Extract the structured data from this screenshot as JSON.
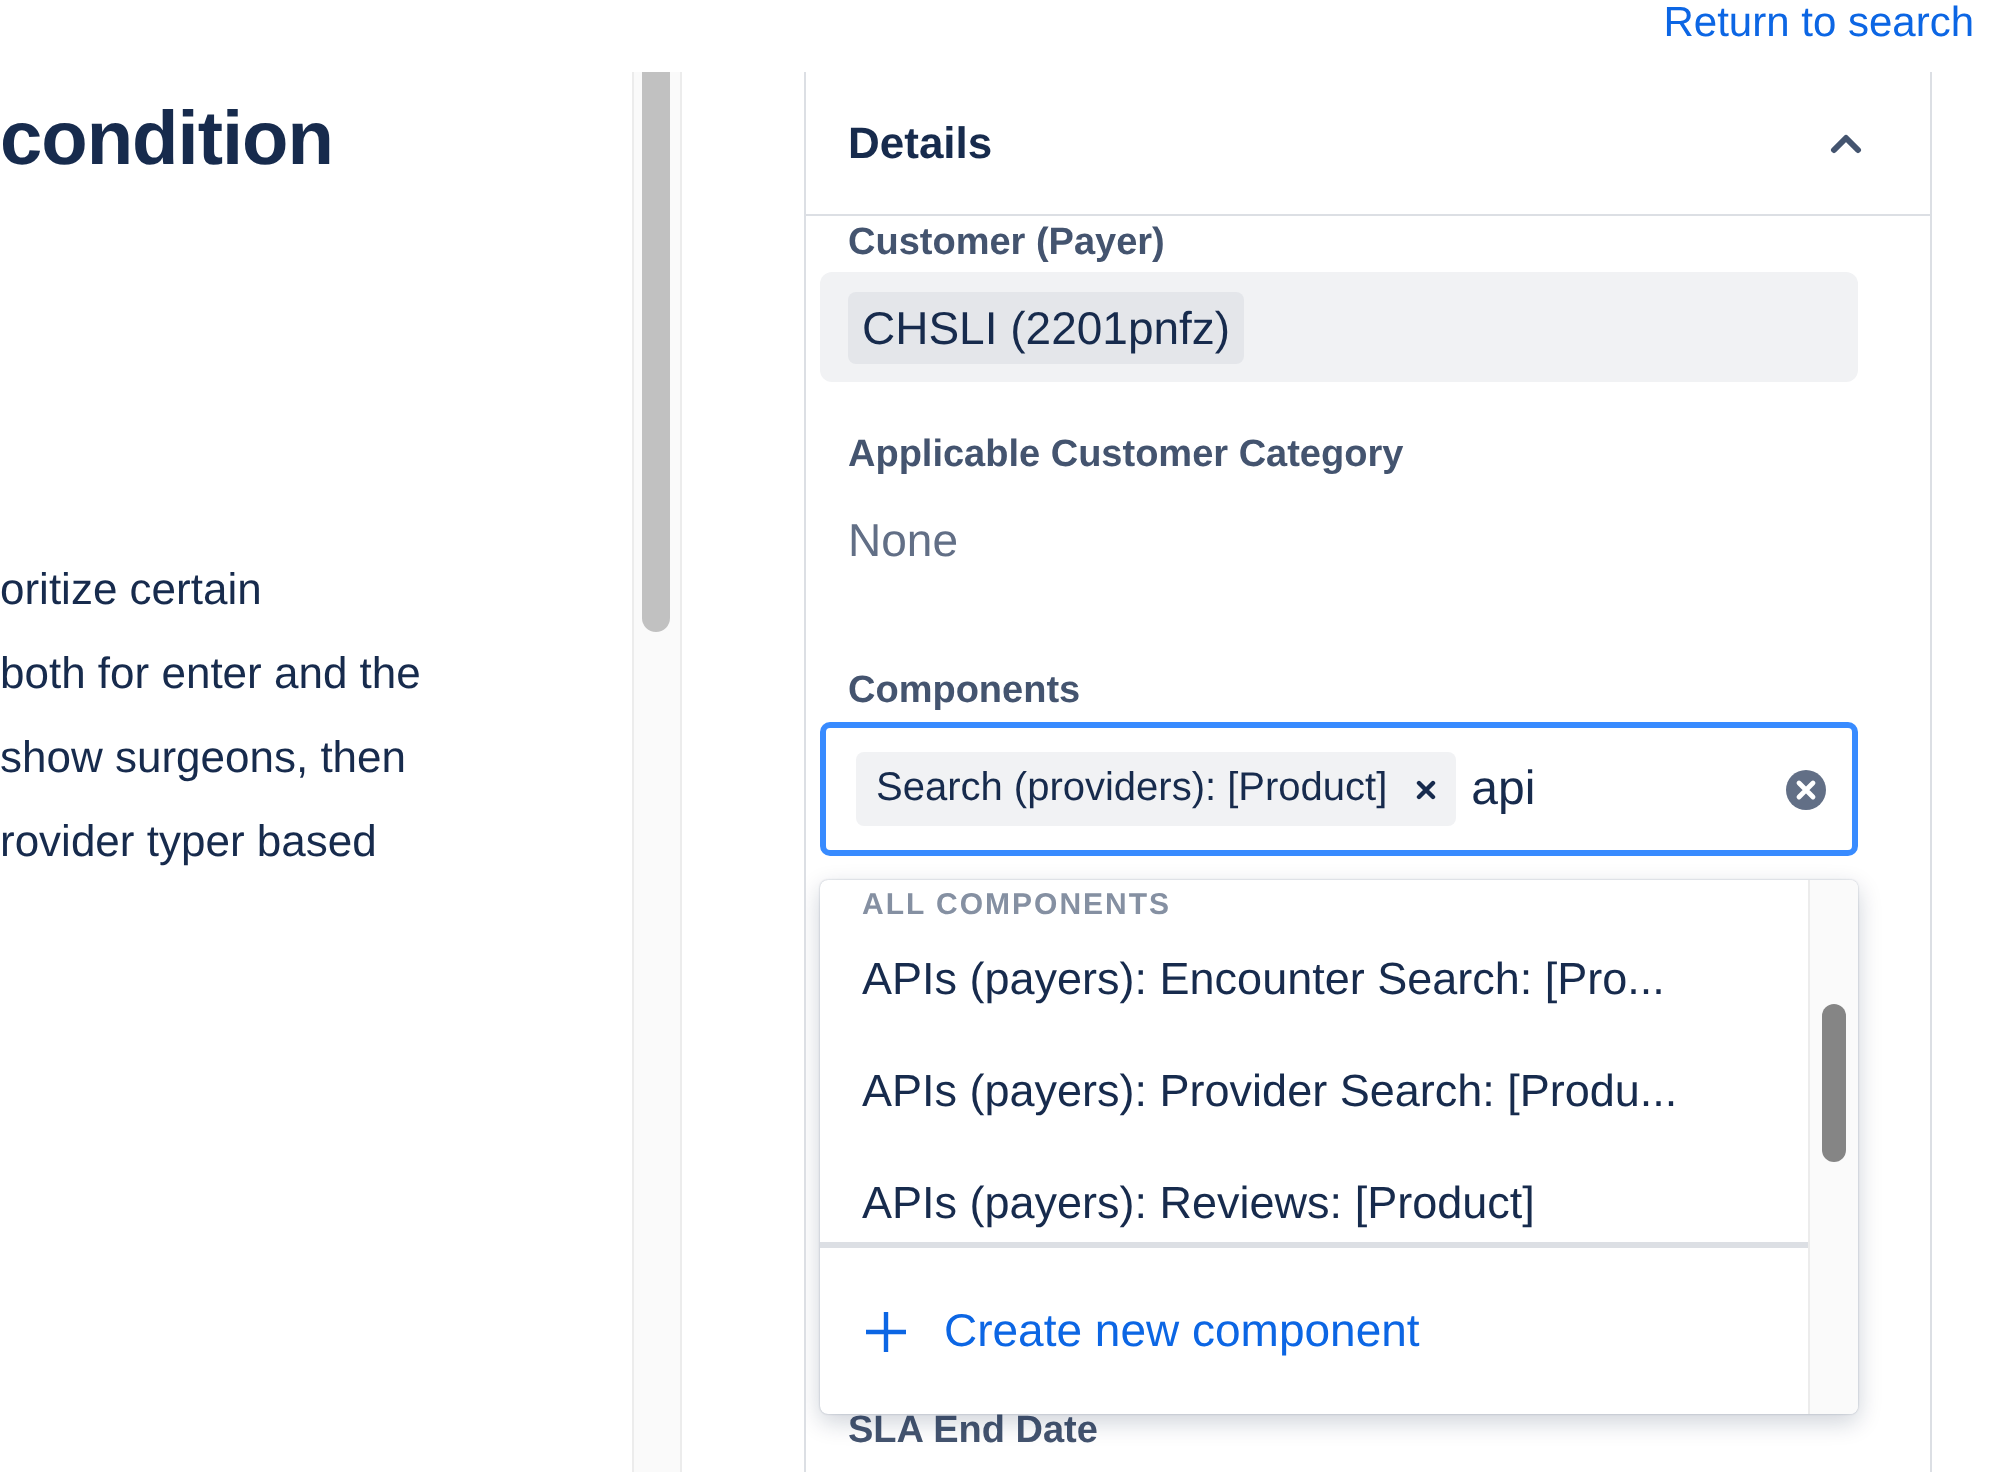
{
  "left": {
    "heading": "condition",
    "lines": [
      "oritize certain",
      "both for enter and the",
      "show surgeons, then",
      "rovider typer based"
    ]
  },
  "return_link": "Return to search",
  "details": {
    "title": "Details",
    "expanded": true,
    "customer": {
      "label": "Customer (Payer)",
      "value": "CHSLI (2201pnfz)"
    },
    "category": {
      "label": "Applicable Customer Category",
      "value": "None"
    },
    "components": {
      "label": "Components",
      "focused": true,
      "tags": [
        "Search (providers): [Product]"
      ],
      "value": "api",
      "dropdown": {
        "group": "ALL COMPONENTS",
        "options": [
          "APIs (payers): Encounter Search: [Pro...",
          "APIs (payers): Provider Search: [Produ...",
          "APIs (payers): Reviews: [Product]"
        ],
        "create": "Create new component"
      }
    },
    "sla": {
      "label": "SLA End Date"
    }
  }
}
